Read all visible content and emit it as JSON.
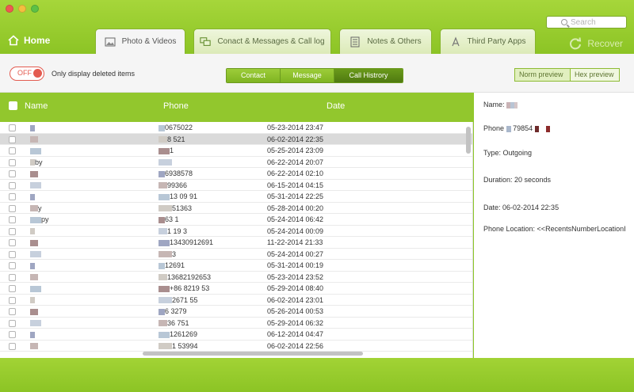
{
  "search": {
    "placeholder": "Search"
  },
  "home": {
    "label": "Home"
  },
  "tabs": [
    {
      "label": "Photo & Videos",
      "icon": "photo-icon"
    },
    {
      "label": "Conact & Messages & Call log",
      "icon": "chat-icon"
    },
    {
      "label": "Notes & Others",
      "icon": "notes-icon"
    },
    {
      "label": "Third Party Apps",
      "icon": "appstore-icon"
    }
  ],
  "recover": {
    "label": "Recover"
  },
  "filter": {
    "toggle_state": "OFF",
    "toggle_label": "Only display deleted items"
  },
  "segments": [
    "Contact",
    "Message",
    "Call Histrory"
  ],
  "preview": {
    "norm": "Norm preview",
    "hex": "Hex preview"
  },
  "table": {
    "headers": {
      "name": "Name",
      "phone": "Phone",
      "date": "Date"
    },
    "rows": [
      {
        "name": "",
        "phone": "0675022",
        "date": "05-23-2014 23:47"
      },
      {
        "name": "",
        "phone": "8 521",
        "date": "06-02-2014 22:35",
        "selected": true
      },
      {
        "name": "",
        "phone": "1 ",
        "date": "05-25-2014 23:09"
      },
      {
        "name": "by",
        "phone": "",
        "date": "06-22-2014 20:07"
      },
      {
        "name": "",
        "phone": "6938578",
        "date": "06-22-2014 02:10"
      },
      {
        "name": "",
        "phone": "99366",
        "date": "06-15-2014 04:15"
      },
      {
        "name": "",
        "phone": "13 09 91",
        "date": "05-31-2014 22:25"
      },
      {
        "name": "y",
        "phone": "51363",
        "date": "05-28-2014 00:20"
      },
      {
        "name": "py",
        "phone": "63 1",
        "date": "05-24-2014 06:42"
      },
      {
        "name": "",
        "phone": "1 19 3",
        "date": "05-24-2014 00:09"
      },
      {
        "name": "",
        "phone": "13430912691",
        "date": "11-22-2014 21:33"
      },
      {
        "name": "",
        "phone": "3",
        "date": "05-24-2014 00:27"
      },
      {
        "name": "",
        "phone": "12691",
        "date": "05-31-2014 00:19"
      },
      {
        "name": "",
        "phone": "13682192653",
        "date": "05-23-2014 23:52"
      },
      {
        "name": "",
        "phone": "+86 8219 53",
        "date": "05-29-2014 08:40"
      },
      {
        "name": "",
        "phone": "2671 55",
        "date": "06-02-2014 23:01"
      },
      {
        "name": "",
        "phone": "6 3279",
        "date": "05-26-2014 00:53"
      },
      {
        "name": "",
        "phone": "36 751",
        "date": "05-29-2014 06:32"
      },
      {
        "name": "",
        "phone": "1261269",
        "date": "06-12-2014 04:47"
      },
      {
        "name": "",
        "phone": "1 53994",
        "date": "06-02-2014 22:56"
      }
    ]
  },
  "details": {
    "name_label": "Name:",
    "phone_label": "Phone",
    "phone_value": "79854",
    "type": "Type: Outgoing",
    "duration": "Duration: 20 seconds",
    "date": "Date: 06-02-2014 22:35",
    "location": "Phone Location: <<RecentsNumberLocationI"
  },
  "colors": {
    "accent_green": "#92c72d",
    "toggle_red": "#e35b50",
    "selected_row": "#dadada"
  }
}
